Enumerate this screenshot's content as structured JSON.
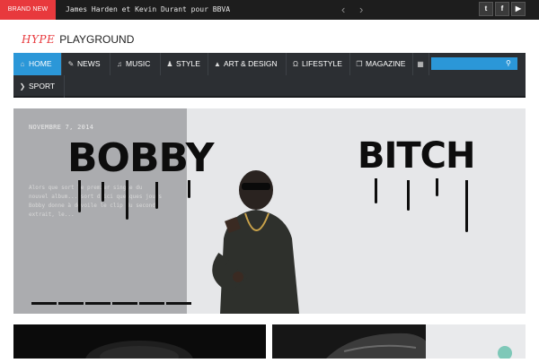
{
  "topbar": {
    "badge": "BRAND NEW",
    "ticker_text": "James Harden et Kevin Durant pour BBVA",
    "prev_icon": "chevron-left-icon",
    "next_icon": "chevron-right-icon",
    "social": [
      {
        "icon": "twitter-icon",
        "glyph": "t"
      },
      {
        "icon": "facebook-icon",
        "glyph": "f"
      },
      {
        "icon": "youtube-icon",
        "glyph": "▶"
      }
    ]
  },
  "logo": {
    "hype": "HYPE",
    "playground": "PLAYGROUND"
  },
  "nav": {
    "items": [
      {
        "label": "HOME",
        "icon": "home-icon",
        "glyph": "⌂",
        "active": true
      },
      {
        "label": "NEWS",
        "icon": "wrench-icon",
        "glyph": "✎"
      },
      {
        "label": "MUSIC",
        "icon": "music-icon",
        "glyph": "♫"
      },
      {
        "label": "STYLE",
        "icon": "people-icon",
        "glyph": "♟"
      },
      {
        "label": "ART & DESIGN",
        "icon": "flask-icon",
        "glyph": "▲"
      },
      {
        "label": "LIFESTYLE",
        "icon": "headphones-icon",
        "glyph": "Ω"
      },
      {
        "label": "MAGAZINE",
        "icon": "copy-icon",
        "glyph": "❐"
      },
      {
        "label": "",
        "icon": "calendar-icon",
        "glyph": "▦"
      },
      {
        "label": "SPORT",
        "icon": "chevron-right-icon",
        "glyph": "❯"
      }
    ],
    "search_placeholder": "",
    "search_icon": "search-icon",
    "accent_color": "#2b97d8"
  },
  "hero": {
    "date": "NOVEMBRE 7, 2014",
    "excerpt": "Alors que sort le premier single du nouvel album... sort d'ici quelques jours Bobby donne à dévoile le clip du second extrait, le...",
    "title_left": "BOBBY",
    "title_right": "BITCH",
    "slides_count": 6
  },
  "colors": {
    "brand_red": "#e8393d",
    "topbar": "#1d1d1d",
    "nav_bg": "#2c2f33"
  }
}
